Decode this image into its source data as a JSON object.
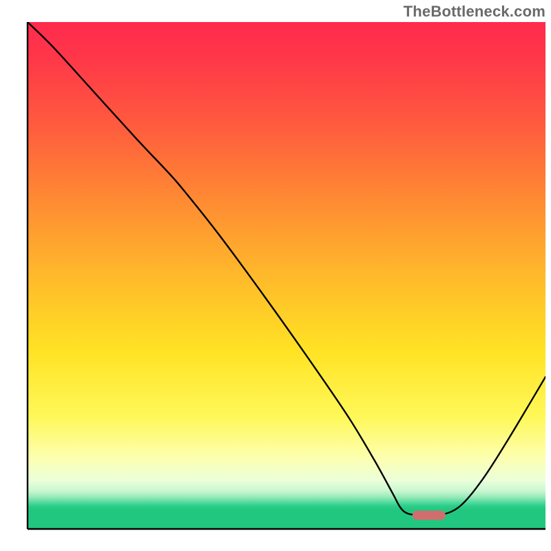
{
  "watermark": "TheBottleneck.com",
  "chart_data": {
    "type": "line",
    "title": "",
    "xlabel": "",
    "ylabel": "",
    "xlim": [
      0,
      100
    ],
    "ylim": [
      0,
      100
    ],
    "grid": false,
    "legend": false,
    "gradient_stops": [
      {
        "offset": 0.0,
        "color": "#ff2a4d"
      },
      {
        "offset": 0.07,
        "color": "#ff3749"
      },
      {
        "offset": 0.2,
        "color": "#ff5a3e"
      },
      {
        "offset": 0.35,
        "color": "#ff8a33"
      },
      {
        "offset": 0.5,
        "color": "#ffb92b"
      },
      {
        "offset": 0.65,
        "color": "#ffe324"
      },
      {
        "offset": 0.78,
        "color": "#fff85a"
      },
      {
        "offset": 0.86,
        "color": "#fdffb0"
      },
      {
        "offset": 0.905,
        "color": "#eaffda"
      },
      {
        "offset": 0.925,
        "color": "#c9f7d0"
      },
      {
        "offset": 0.938,
        "color": "#92e9b6"
      },
      {
        "offset": 0.948,
        "color": "#4fd99d"
      },
      {
        "offset": 0.955,
        "color": "#2bcd88"
      },
      {
        "offset": 0.962,
        "color": "#22c77f"
      },
      {
        "offset": 1.0,
        "color": "#22c77f"
      }
    ],
    "series": [
      {
        "name": "bottleneck-curve",
        "x": [
          0.0,
          5.0,
          13.0,
          21.0,
          27.0,
          30.0,
          37.0,
          46.0,
          55.0,
          62.0,
          67.0,
          70.5,
          72.0,
          73.5,
          76.0,
          79.5,
          83.5,
          88.0,
          93.0,
          100.0
        ],
        "y": [
          100.0,
          95.0,
          86.0,
          77.0,
          70.5,
          67.0,
          58.0,
          45.5,
          32.5,
          22.0,
          13.5,
          7.0,
          4.2,
          3.0,
          2.7,
          2.7,
          4.5,
          10.0,
          18.0,
          30.0
        ]
      }
    ],
    "marker": {
      "name": "optimal-marker",
      "x": 77.5,
      "y": 2.7,
      "rx": 3.2,
      "ry": 0.9,
      "color": "#d26d6f"
    },
    "axes": {
      "left": {
        "from": [
          5,
          4
        ],
        "to": [
          5,
          96
        ]
      },
      "bottom": {
        "from": [
          5,
          96
        ],
        "to": [
          99,
          96
        ]
      }
    }
  }
}
